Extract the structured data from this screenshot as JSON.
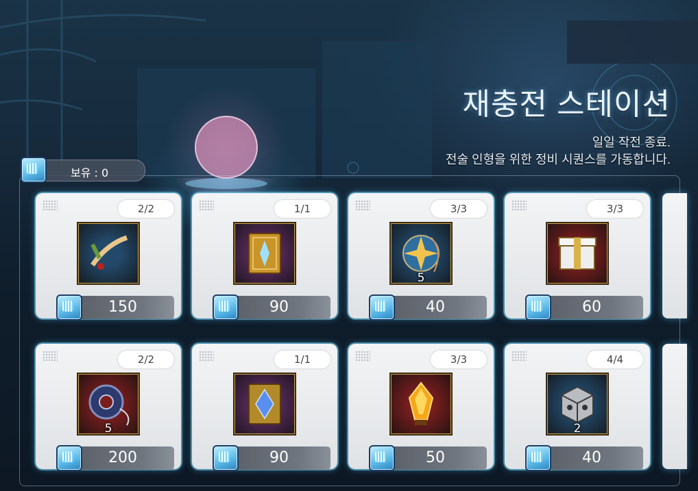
{
  "header": {
    "title": "재충전 스테이션",
    "subtitle_line1": "일일 작전 종료.",
    "subtitle_line2": "전술 인형을 위한 정비 시퀀스를 가동합니다."
  },
  "currency": {
    "label": "보유 : 0",
    "icon": "data-chip-icon"
  },
  "items": [
    {
      "stock": "2/2",
      "icon": "root-herb-icon",
      "qty": "",
      "price": "150",
      "bg": "#23496a"
    },
    {
      "stock": "1/1",
      "icon": "golden-book-icon",
      "qty": "",
      "price": "90",
      "bg": "#5a2a5e"
    },
    {
      "stock": "3/3",
      "icon": "star-amulet-icon",
      "qty": "5",
      "price": "40",
      "bg": "#23496a"
    },
    {
      "stock": "3/3",
      "icon": "treasure-box-icon",
      "qty": "",
      "price": "60",
      "bg": "#7a1d1d"
    },
    {
      "stock": "2/2",
      "icon": "tape-coil-icon",
      "qty": "5",
      "price": "200",
      "bg": "#7a1d1d"
    },
    {
      "stock": "1/1",
      "icon": "crystal-book-icon",
      "qty": "",
      "price": "90",
      "bg": "#5a2a5e"
    },
    {
      "stock": "3/3",
      "icon": "fire-crystal-icon",
      "qty": "",
      "price": "50",
      "bg": "#7a1d1d"
    },
    {
      "stock": "4/4",
      "icon": "steel-cube-icon",
      "qty": "2",
      "price": "40",
      "bg": "#23496a"
    }
  ]
}
